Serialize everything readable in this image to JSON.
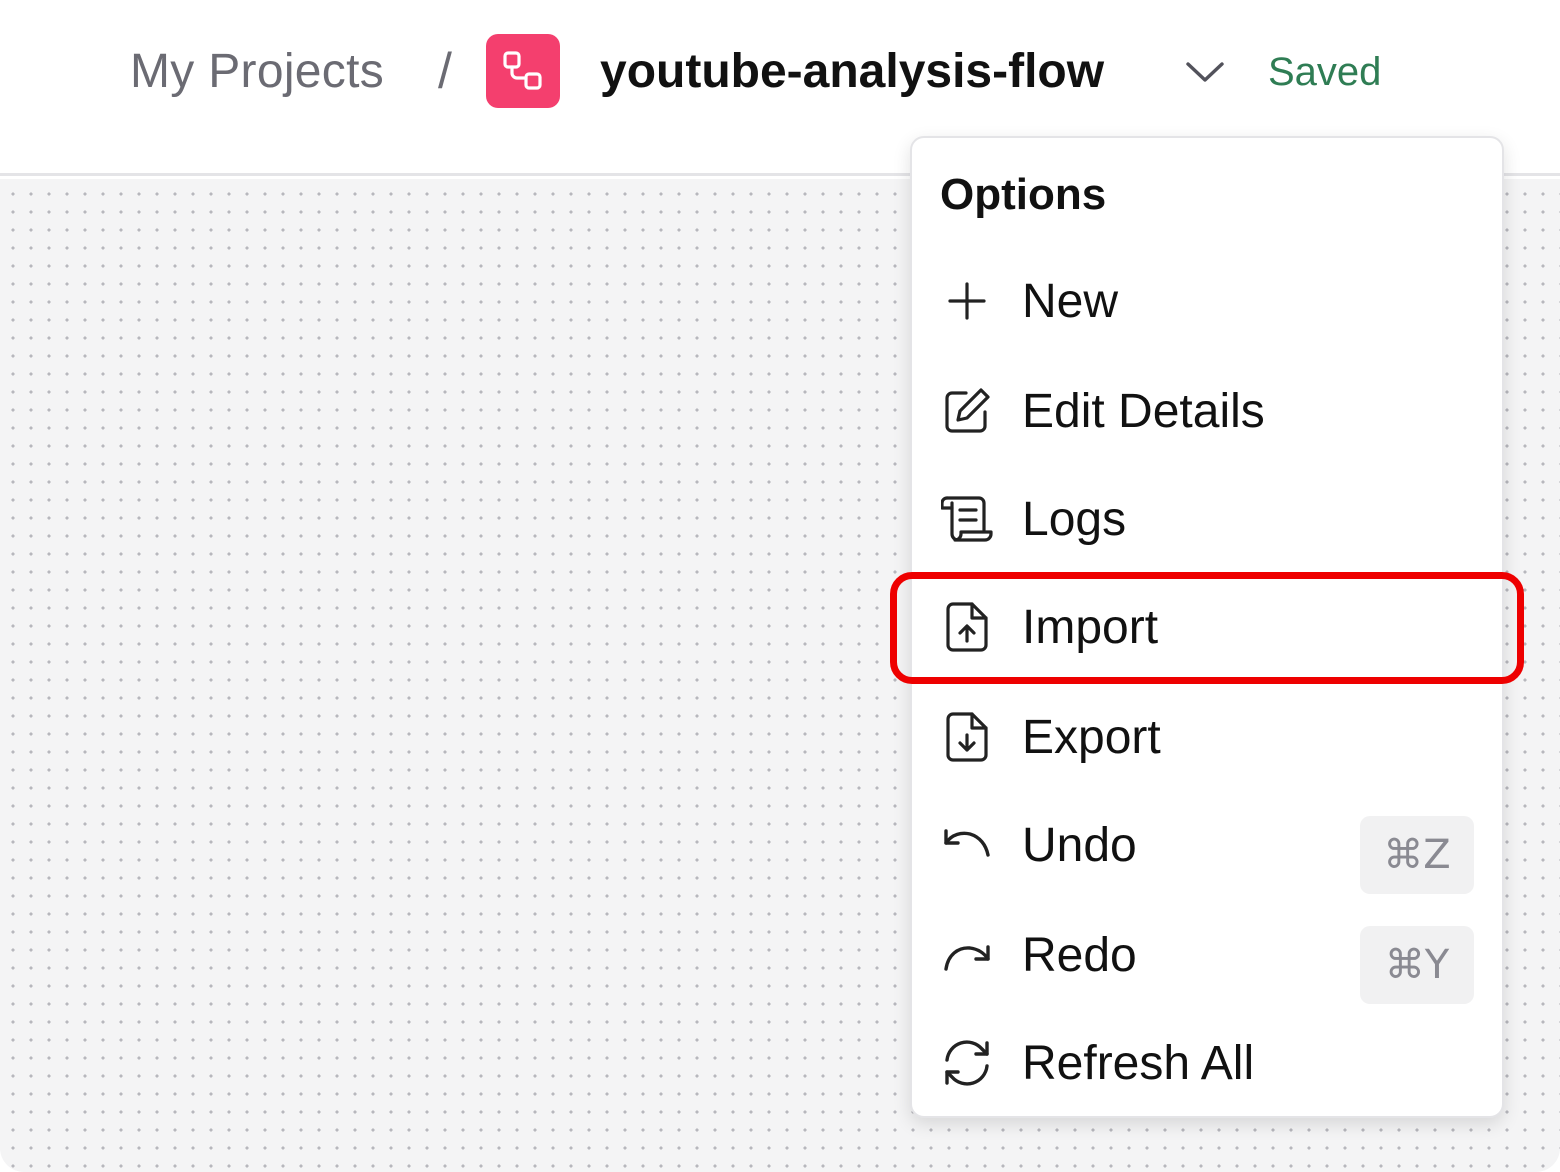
{
  "header": {
    "breadcrumb_root": "My Projects",
    "separator": "/",
    "flow_name": "youtube-analysis-flow",
    "status": "Saved"
  },
  "menu": {
    "title": "Options",
    "items": [
      {
        "label": "New",
        "icon": "plus-icon"
      },
      {
        "label": "Edit Details",
        "icon": "pencil-square-icon"
      },
      {
        "label": "Logs",
        "icon": "scroll-icon"
      },
      {
        "label": "Import",
        "icon": "file-upload-icon",
        "highlighted": true
      },
      {
        "label": "Export",
        "icon": "file-download-icon"
      },
      {
        "label": "Undo",
        "icon": "undo-icon",
        "shortcut": "⌘Z"
      },
      {
        "label": "Redo",
        "icon": "redo-icon",
        "shortcut": "⌘Y"
      },
      {
        "label": "Refresh All",
        "icon": "refresh-icon"
      }
    ]
  },
  "colors": {
    "badge": "#f43f6e",
    "saved": "#2f7d54",
    "highlight": "#ee0000"
  }
}
